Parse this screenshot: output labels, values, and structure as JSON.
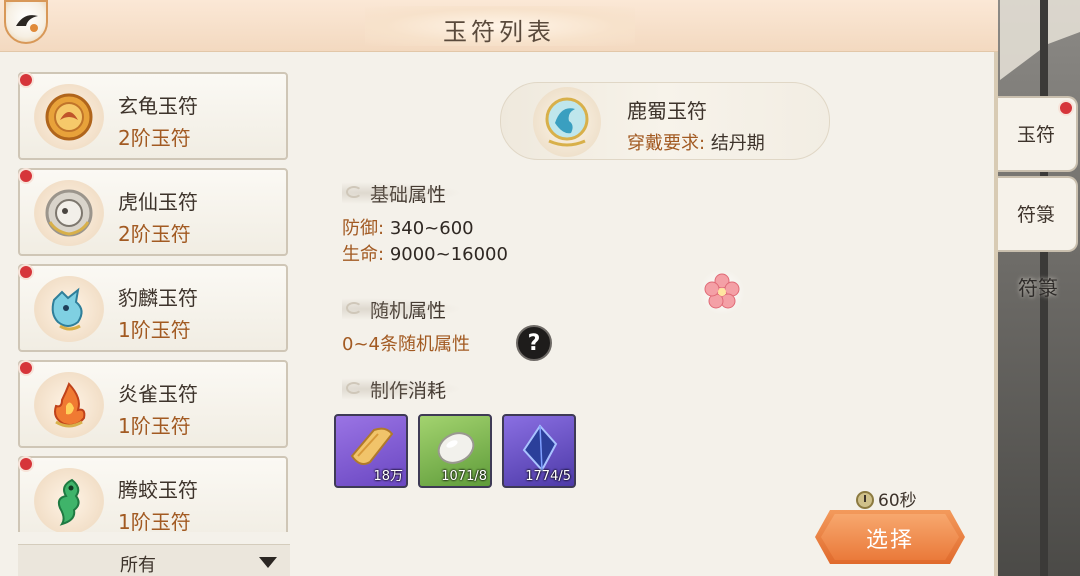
{
  "header": {
    "title": "玉符列表"
  },
  "list": {
    "items": [
      {
        "name": "玄龟玉符",
        "tier": "2阶玉符",
        "icon": "turtle-talisman-icon",
        "has_badge": true
      },
      {
        "name": "虎仙玉符",
        "tier": "2阶玉符",
        "icon": "tiger-talisman-icon",
        "has_badge": true
      },
      {
        "name": "豹麟玉符",
        "tier": "1阶玉符",
        "icon": "leopard-talisman-icon",
        "has_badge": true
      },
      {
        "name": "炎雀玉符",
        "tier": "1阶玉符",
        "icon": "flame-bird-talisman-icon",
        "has_badge": true
      },
      {
        "name": "腾蛟玉符",
        "tier": "1阶玉符",
        "icon": "jiao-dragon-talisman-icon",
        "has_badge": true
      }
    ],
    "filter": {
      "selected": "所有"
    }
  },
  "detail": {
    "name": "鹿蜀玉符",
    "requirement_label": "穿戴要求:",
    "requirement_value": "结丹期",
    "base_section": "基础属性",
    "attributes": [
      {
        "label": "防御:",
        "value": "340~600"
      },
      {
        "label": "生命:",
        "value": "9000~16000"
      }
    ],
    "random_section": "随机属性",
    "random_text": "0~4条随机属性",
    "help_glyph": "?",
    "cost_section": "制作消耗",
    "materials": [
      {
        "icon": "paper-scroll-icon",
        "qty": "18万",
        "rarity": "purple"
      },
      {
        "icon": "jade-stone-icon",
        "qty": "1071/8",
        "rarity": "green"
      },
      {
        "icon": "crystal-shard-icon",
        "qty": "1774/5",
        "rarity": "blue"
      }
    ]
  },
  "footer": {
    "timer": "60秒",
    "select_label": "选择"
  },
  "tabs": [
    {
      "label": "玉符",
      "has_badge": true
    },
    {
      "label": "符箓",
      "has_badge": false
    }
  ],
  "background_tab_label": "符箓",
  "colors": {
    "accent_brown": "#a25a22",
    "badge_red": "#d6353a",
    "button_orange": "#ea7a3a",
    "panel_bg": "#f4f1ea"
  }
}
